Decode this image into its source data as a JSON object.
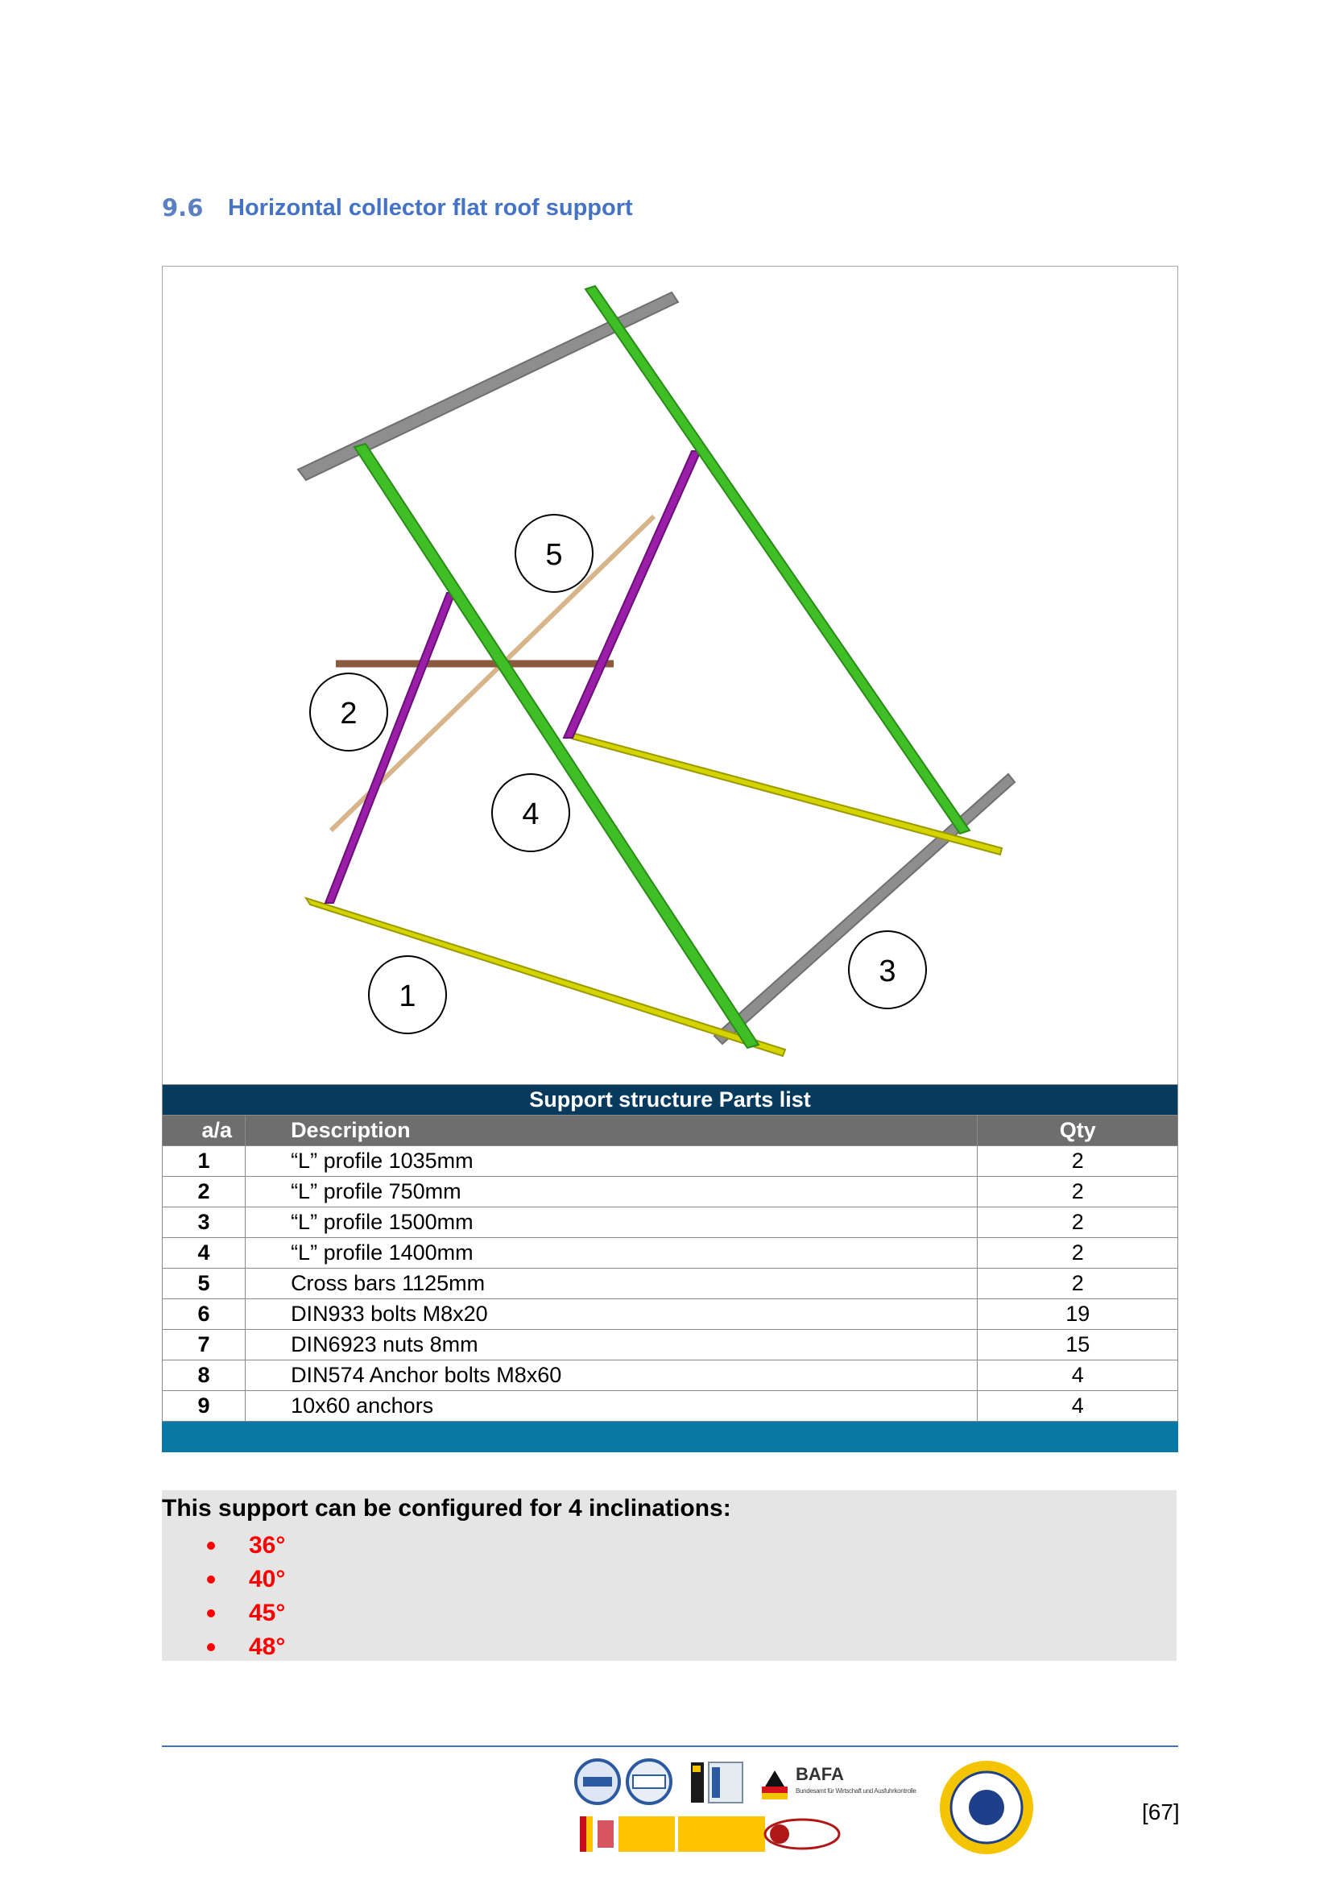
{
  "section": {
    "number": "9.6",
    "title": "Horizontal collector flat roof support"
  },
  "figure": {
    "callouts": [
      "5",
      "2",
      "4",
      "1",
      "3"
    ]
  },
  "parts_table": {
    "caption": "Support structure Parts list",
    "headers": {
      "aa": "a/a",
      "description": "Description",
      "qty": "Qty"
    },
    "rows": [
      {
        "aa": "1",
        "description": "“L” profile 1035mm",
        "qty": "2"
      },
      {
        "aa": "2",
        "description": "“L” profile 750mm",
        "qty": "2"
      },
      {
        "aa": "3",
        "description": "“L” profile 1500mm",
        "qty": "2"
      },
      {
        "aa": "4",
        "description": "“L” profile 1400mm",
        "qty": "2"
      },
      {
        "aa": "5",
        "description": "Cross bars 1125mm",
        "qty": "2"
      },
      {
        "aa": "6",
        "description": "DIN933 bolts M8x20",
        "qty": "19"
      },
      {
        "aa": "7",
        "description": "DIN6923 nuts 8mm",
        "qty": "15"
      },
      {
        "aa": "8",
        "description": "DIN574 Anchor bolts M8x60",
        "qty": "4"
      },
      {
        "aa": "9",
        "description": "10x60 anchors",
        "qty": "4"
      }
    ]
  },
  "inclinations": {
    "intro": "This support can be configured for 4 inclinations:",
    "items": [
      "36°",
      "40°",
      "45°",
      "48°"
    ]
  },
  "footer": {
    "logos": {
      "bafa": "BAFA",
      "bafa_sub": "Bundesamt für Wirtschaft und Ausfuhrkontrolle"
    },
    "page_number": "[67]"
  },
  "colors": {
    "heading": "#4472c4",
    "table_caption_bg": "#073a5c",
    "table_header_bg": "#6e6e6e",
    "table_footer_bg": "#0878a5",
    "inclination_text": "#ff0000",
    "note_bg": "#e5e5e5"
  }
}
